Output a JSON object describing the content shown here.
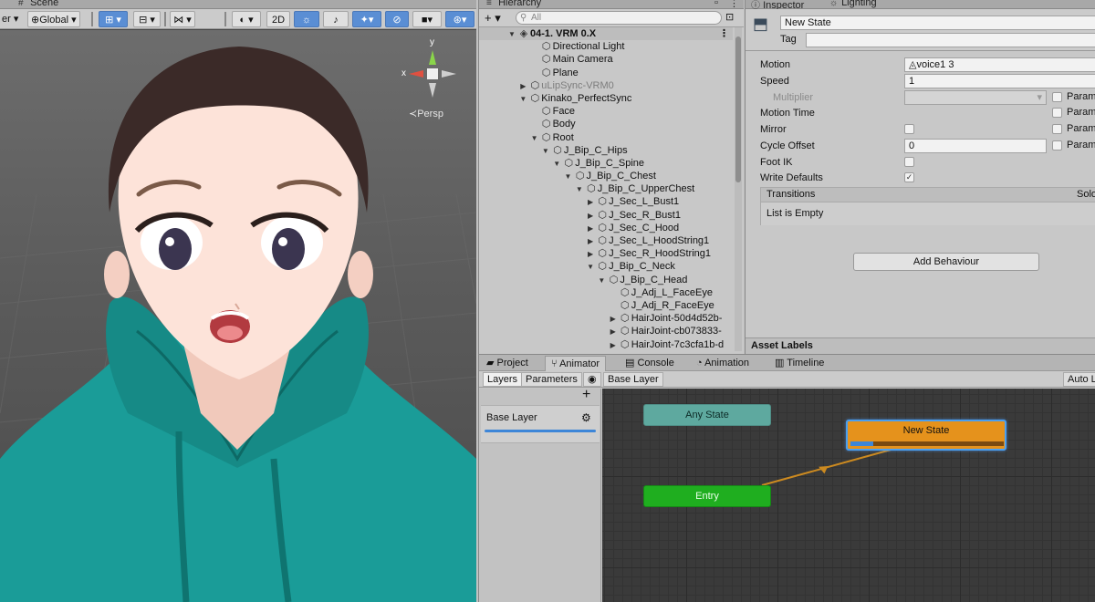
{
  "scene": {
    "tab": "Scene",
    "toolbar": {
      "shading_mode": "er",
      "pivot": "Global",
      "mode_2d": "2D"
    },
    "gizmo": {
      "y": "y",
      "x": "x"
    },
    "projection": "Persp"
  },
  "hierarchy": {
    "tab": "Hierarchy",
    "add": "+",
    "search_placeholder": "All",
    "items": [
      {
        "label": "04-1. VRM 0.X"
      },
      {
        "label": "Directional Light"
      },
      {
        "label": "Main Camera"
      },
      {
        "label": "Plane"
      },
      {
        "label": "uLipSync-VRM0"
      },
      {
        "label": "Kinako_PerfectSync"
      },
      {
        "label": "Face"
      },
      {
        "label": "Body"
      },
      {
        "label": "Root"
      },
      {
        "label": "J_Bip_C_Hips"
      },
      {
        "label": "J_Bip_C_Spine"
      },
      {
        "label": "J_Bip_C_Chest"
      },
      {
        "label": "J_Bip_C_UpperChest"
      },
      {
        "label": "J_Sec_L_Bust1"
      },
      {
        "label": "J_Sec_R_Bust1"
      },
      {
        "label": "J_Sec_C_Hood"
      },
      {
        "label": "J_Sec_L_HoodString1"
      },
      {
        "label": "J_Sec_R_HoodString1"
      },
      {
        "label": "J_Bip_C_Neck"
      },
      {
        "label": "J_Bip_C_Head"
      },
      {
        "label": "J_Adj_L_FaceEye"
      },
      {
        "label": "J_Adj_R_FaceEye"
      },
      {
        "label": "HairJoint-50d4d52b-"
      },
      {
        "label": "HairJoint-cb073833-"
      },
      {
        "label": "HairJoint-7c3cfa1b-d"
      }
    ]
  },
  "inspector": {
    "tabs": {
      "inspector": "Inspector",
      "lighting": "Lighting"
    },
    "name": "New State",
    "tag_label": "Tag",
    "props": {
      "motion": {
        "label": "Motion",
        "value": "voice1 3"
      },
      "speed": {
        "label": "Speed",
        "value": "1"
      },
      "multiplier": {
        "label": "Multiplier"
      },
      "motion_time": {
        "label": "Motion Time"
      },
      "mirror": {
        "label": "Mirror"
      },
      "cycle_offset": {
        "label": "Cycle Offset",
        "value": "0"
      },
      "foot_ik": {
        "label": "Foot IK"
      },
      "write_defaults": {
        "label": "Write Defaults",
        "check": "✓"
      },
      "param": "Param"
    },
    "transitions": {
      "title": "Transitions",
      "solo": "Solo",
      "empty": "List is Empty"
    },
    "add_behaviour": "Add Behaviour",
    "asset_labels": "Asset Labels"
  },
  "bottom": {
    "tabs": {
      "project": "Project",
      "animator": "Animator",
      "console": "Console",
      "animation": "Animation",
      "timeline": "Timeline"
    },
    "layers_btn": "Layers",
    "parameters_btn": "Parameters",
    "breadcrumb": "Base Layer",
    "auto_live": "Auto L",
    "add": "+",
    "layer_name": "Base Layer",
    "nodes": {
      "any_state": "Any State",
      "entry": "Entry",
      "new_state": "New State"
    },
    "state_progress": 0.15
  }
}
